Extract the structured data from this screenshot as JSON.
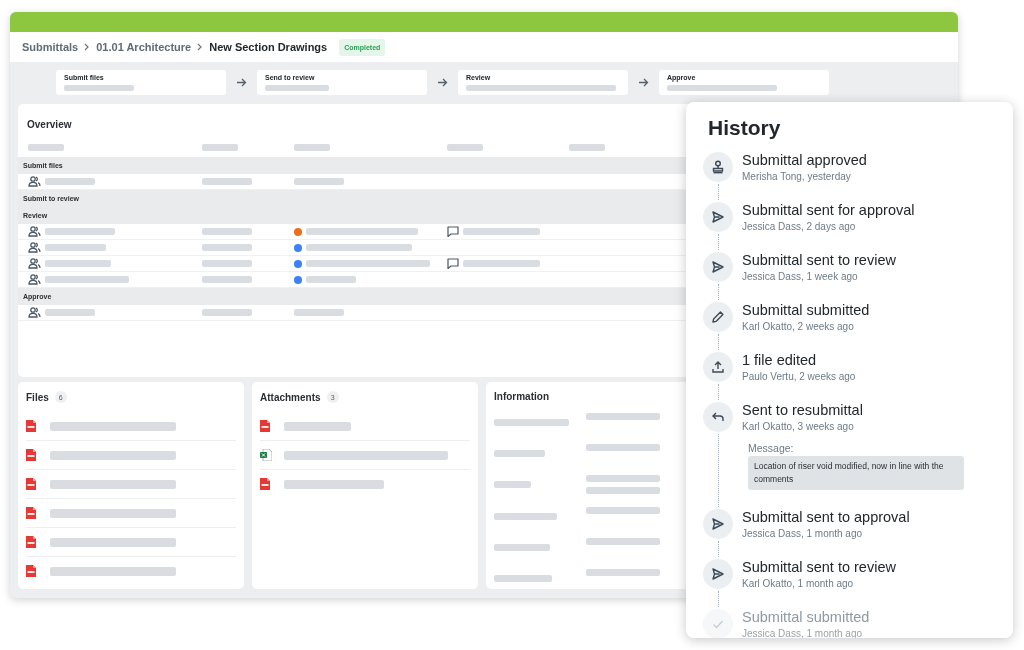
{
  "breadcrumb": [
    {
      "label": "Submittals",
      "current": false
    },
    {
      "label": "01.01 Architecture",
      "current": false
    },
    {
      "label": "New Section Drawings",
      "current": true
    }
  ],
  "status_badge": "Completed",
  "steps": [
    "Submit files",
    "Send to review",
    "Review",
    "Approve"
  ],
  "overview": {
    "title": "Overview",
    "groups": [
      {
        "title": "Submit files",
        "rows": [
          {
            "comment": false
          }
        ]
      },
      {
        "title": "Submit to review"
      },
      {
        "title": "Review",
        "rows": [
          {
            "color": "#f26b1d",
            "comment": true
          },
          {
            "color": "#3b82f6",
            "comment": false
          },
          {
            "color": "#3b82f6",
            "comment": true
          },
          {
            "color": "#3b82f6",
            "comment": false
          }
        ]
      },
      {
        "title": "Approve",
        "rows": [
          {
            "comment": false
          }
        ]
      }
    ]
  },
  "files": {
    "title": "Files",
    "count": "6",
    "items": [
      {
        "kind": "pdf"
      },
      {
        "kind": "pdf"
      },
      {
        "kind": "pdf"
      },
      {
        "kind": "pdf"
      },
      {
        "kind": "pdf"
      },
      {
        "kind": "pdf"
      }
    ]
  },
  "attachments": {
    "title": "Attachments",
    "count": "3",
    "items": [
      {
        "kind": "pdf"
      },
      {
        "kind": "xlsx"
      },
      {
        "kind": "pdf"
      }
    ]
  },
  "information": {
    "title": "Information"
  },
  "history": {
    "title": "History",
    "items": [
      {
        "kind": "stamp",
        "title": "Submittal approved",
        "meta": "Merisha Tong, yesterday",
        "faded": false
      },
      {
        "kind": "send",
        "title": "Submittal sent for approval",
        "meta": "Jessica Dass, 2 days ago",
        "faded": false
      },
      {
        "kind": "send",
        "title": "Submittal sent to review",
        "meta": "Jessica Dass, 1 week ago",
        "faded": false
      },
      {
        "kind": "pencil",
        "title": "Submittal submitted",
        "meta": "Karl Okatto, 2 weeks ago",
        "faded": false
      },
      {
        "kind": "upload",
        "title": "1 file edited",
        "meta": "Paulo Vertu, 2 weeks ago",
        "faded": false
      },
      {
        "kind": "reply",
        "title": "Sent to resubmittal",
        "meta": "Karl Okatto, 3 weeks ago",
        "message_label": "Message:",
        "message": "Location of riser void modified, now in line with the comments",
        "faded": false
      },
      {
        "kind": "send",
        "title": "Submittal sent to approval",
        "meta": "Jessica Dass, 1 month ago",
        "faded": false
      },
      {
        "kind": "send",
        "title": "Submittal sent to review",
        "meta": "Karl Okatto, 1 month ago",
        "faded": false
      },
      {
        "kind": "check",
        "title": "Submittal submitted",
        "meta": "Jessica Dass, 1 month ago",
        "faded": true
      }
    ]
  }
}
